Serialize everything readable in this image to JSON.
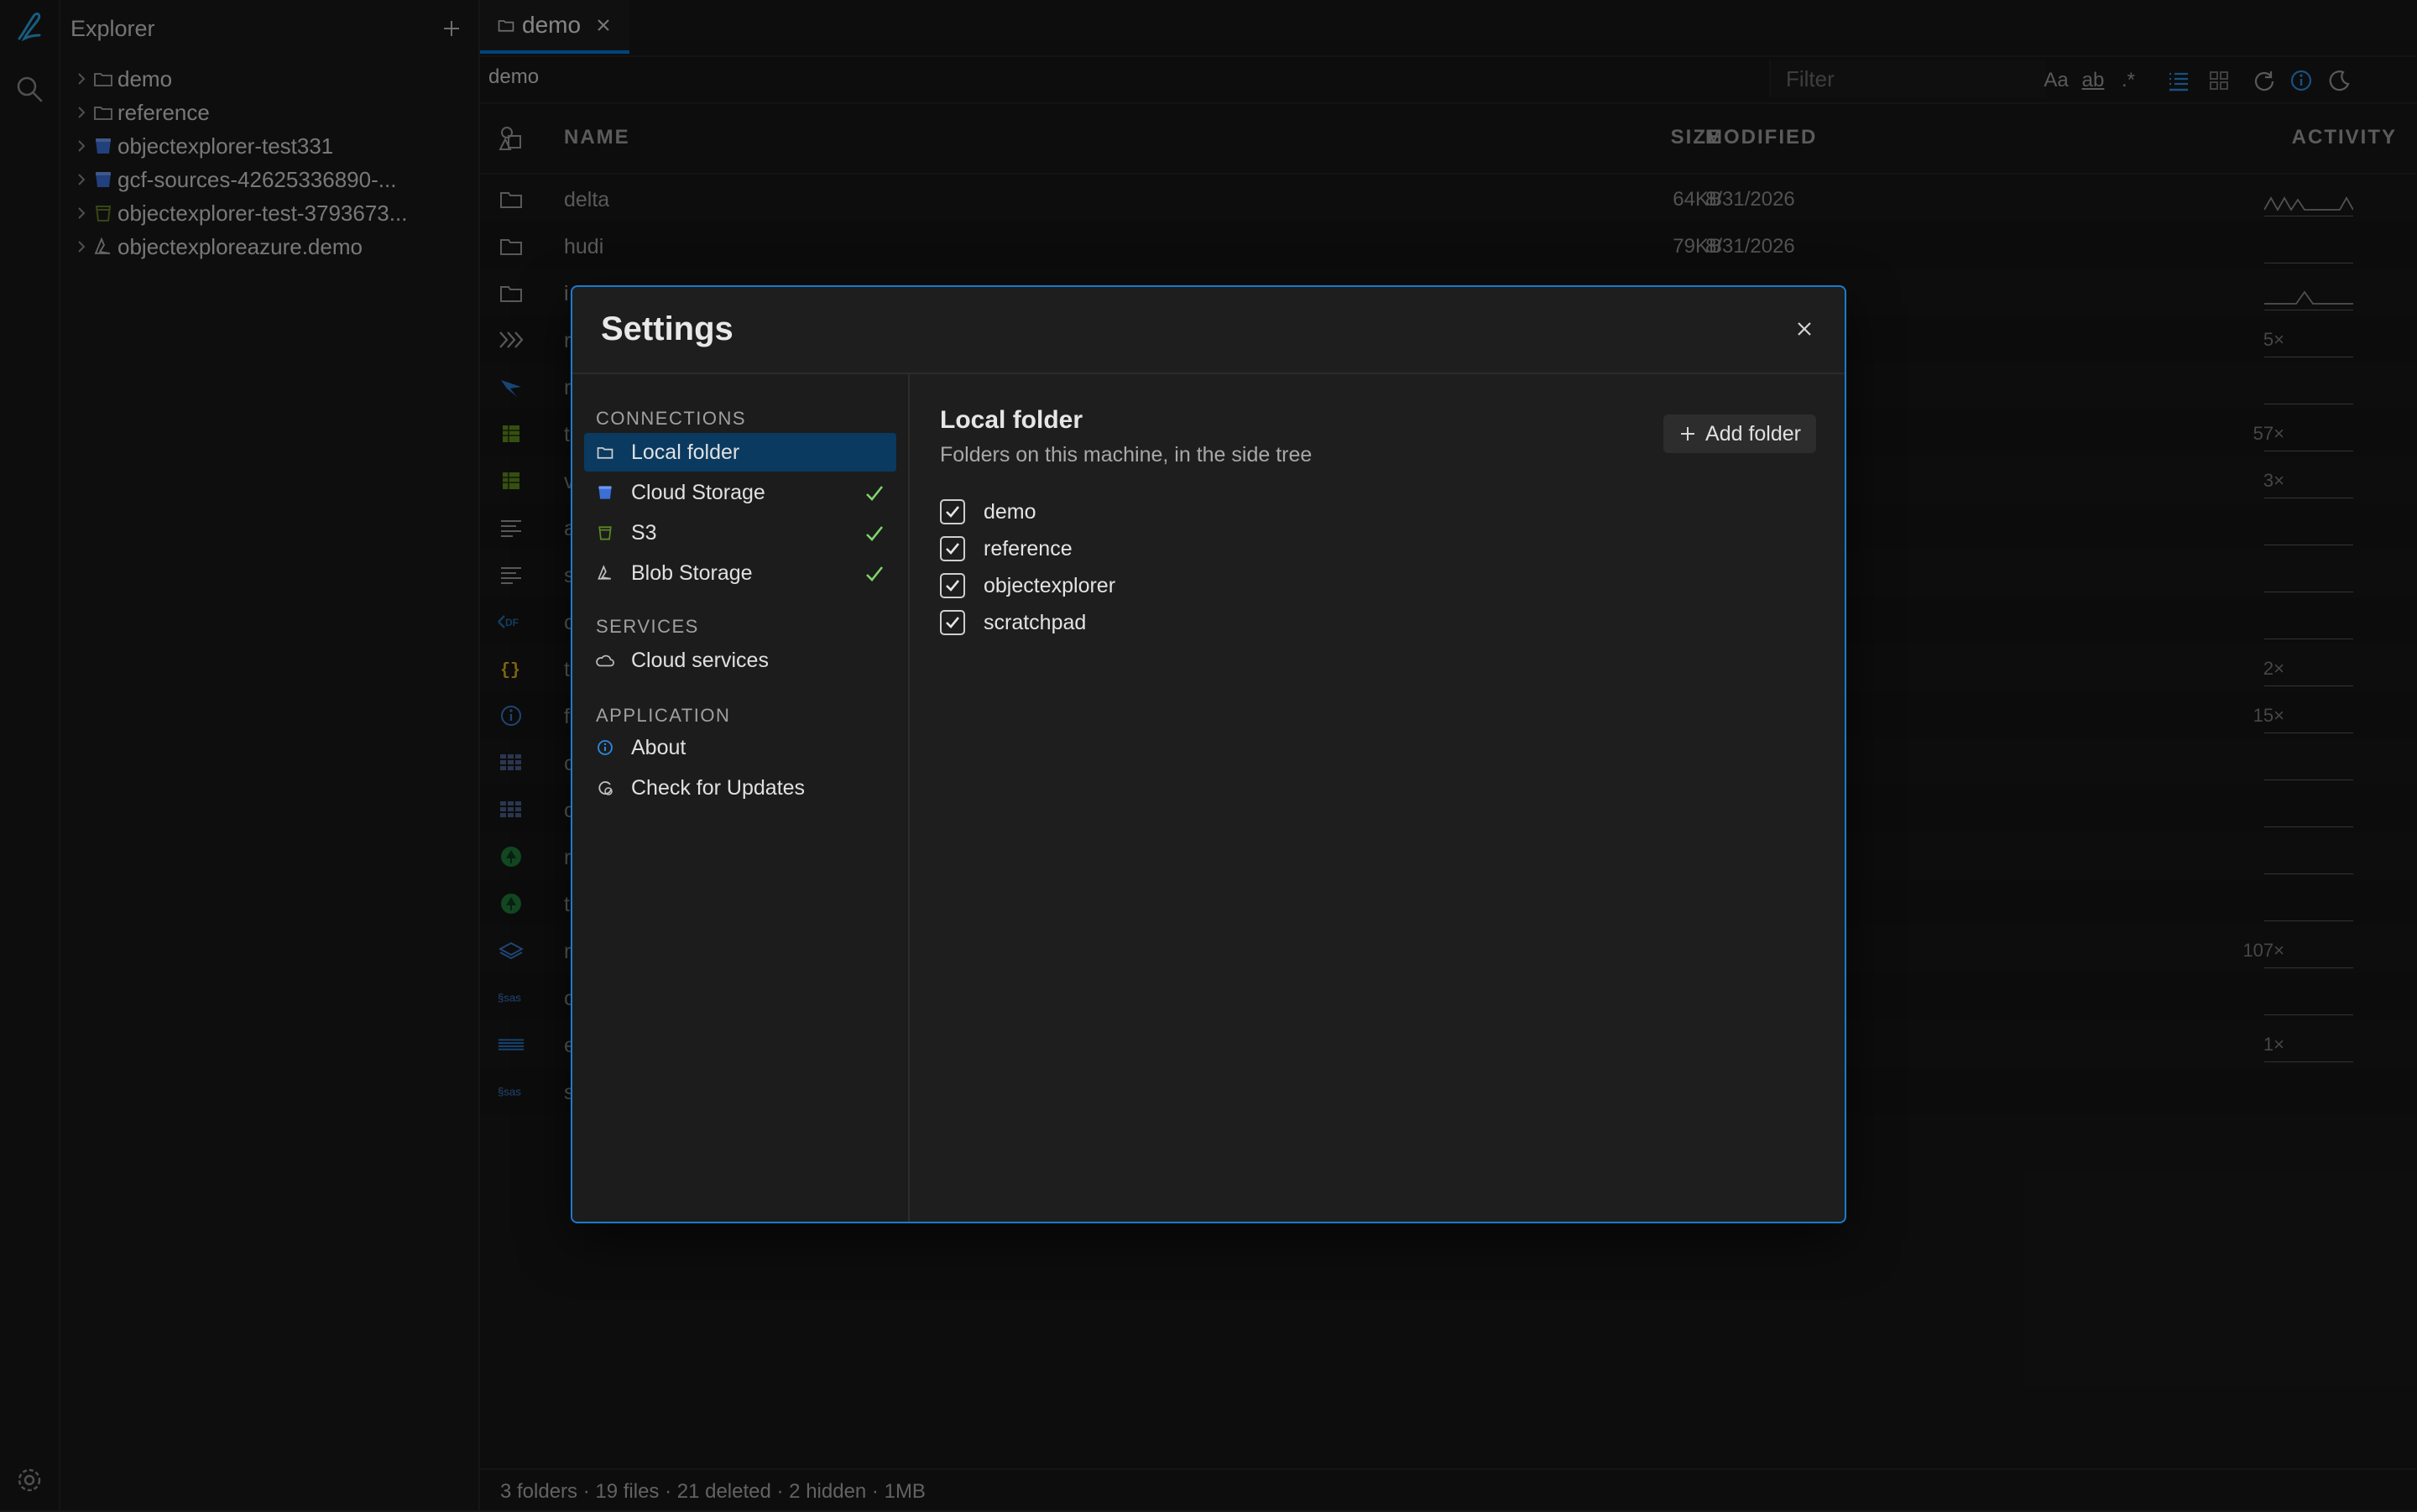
{
  "explorer": {
    "title": "Explorer",
    "items": [
      {
        "label": "demo",
        "icon": "folder-icon"
      },
      {
        "label": "reference",
        "icon": "folder-icon"
      },
      {
        "label": "objectexplorer-test331",
        "icon": "bucket-icon"
      },
      {
        "label": "gcf-sources-42625336890-...",
        "icon": "bucket-icon"
      },
      {
        "label": "objectexplorer-test-3793673...",
        "icon": "s3-icon"
      },
      {
        "label": "objectexploreazure.demo",
        "icon": "azure-icon"
      }
    ]
  },
  "tab": {
    "label": "demo"
  },
  "toolbar": {
    "breadcrumb": "demo",
    "filter_placeholder": "Filter",
    "case_label": "Aa",
    "word_label": "ab",
    "regex_label": ".*"
  },
  "table": {
    "headers": {
      "name": "NAME",
      "size": "SIZE",
      "modified": "MODIFIED",
      "activity": "ACTIVITY"
    },
    "rows": [
      {
        "name": "delta",
        "size": "64KB",
        "modified": "8/31/2026",
        "count": "",
        "icon": "folder-icon",
        "spark": "wave"
      },
      {
        "name": "hudi",
        "size": "79KB",
        "modified": "8/31/2026",
        "count": "",
        "icon": "folder-icon",
        "spark": "flat"
      },
      {
        "name": "i",
        "size": "",
        "modified": "",
        "count": "",
        "icon": "folder-icon",
        "spark": "peak"
      },
      {
        "name": "r",
        "size": "",
        "modified": "",
        "count": "5×",
        "icon": "chevrons-icon",
        "spark": "flat"
      },
      {
        "name": "r",
        "size": "",
        "modified": "",
        "count": "",
        "icon": "bird-icon",
        "spark": "flat"
      },
      {
        "name": "t",
        "size": "",
        "modified": "",
        "count": "57×",
        "icon": "sheet-icon",
        "spark": "flat"
      },
      {
        "name": "v",
        "size": "",
        "modified": "",
        "count": "3×",
        "icon": "sheet-icon",
        "spark": "flat"
      },
      {
        "name": "a",
        "size": "",
        "modified": "",
        "count": "",
        "icon": "text-icon",
        "spark": "flat"
      },
      {
        "name": "s",
        "size": "",
        "modified": "",
        "count": "",
        "icon": "text-icon",
        "spark": "flat"
      },
      {
        "name": "c",
        "size": "",
        "modified": "",
        "count": "",
        "icon": "hdf-icon",
        "spark": "flat"
      },
      {
        "name": "t",
        "size": "",
        "modified": "",
        "count": "2×",
        "icon": "json-icon",
        "spark": "flat"
      },
      {
        "name": "f",
        "size": "",
        "modified": "",
        "count": "15×",
        "icon": "info-icon",
        "spark": "flat"
      },
      {
        "name": "c",
        "size": "",
        "modified": "",
        "count": "",
        "icon": "grid-icon",
        "spark": "flat"
      },
      {
        "name": "c",
        "size": "",
        "modified": "",
        "count": "",
        "icon": "grid-icon",
        "spark": "flat"
      },
      {
        "name": "r",
        "size": "",
        "modified": "",
        "count": "",
        "icon": "tree-icon",
        "spark": "flat"
      },
      {
        "name": "t",
        "size": "",
        "modified": "",
        "count": "",
        "icon": "tree-icon",
        "spark": "flat"
      },
      {
        "name": "r",
        "size": "",
        "modified": "",
        "count": "107×",
        "icon": "layers-icon",
        "spark": "flat"
      },
      {
        "name": "c",
        "size": "",
        "modified": "",
        "count": "",
        "icon": "sas-icon",
        "spark": "flat"
      },
      {
        "name": "e",
        "size": "",
        "modified": "",
        "count": "1×",
        "icon": "ibm-icon",
        "spark": "flat"
      },
      {
        "name": "s",
        "size": "",
        "modified": "",
        "count": "",
        "icon": "sas-icon",
        "spark": ""
      }
    ]
  },
  "status": {
    "text": "3 folders · 19 files · 21 deleted · 2 hidden · 1MB"
  },
  "settings": {
    "title": "Settings",
    "nav": {
      "section_connections": "CONNECTIONS",
      "section_services": "SERVICES",
      "section_application": "APPLICATION",
      "local_folder": "Local folder",
      "cloud_storage": "Cloud Storage",
      "s3": "S3",
      "blob_storage": "Blob Storage",
      "cloud_services": "Cloud services",
      "about": "About",
      "check_updates": "Check for Updates"
    },
    "content": {
      "title": "Local folder",
      "subtitle": "Folders on this machine, in the side tree",
      "add_button": "Add folder",
      "folders": [
        {
          "label": "demo",
          "checked": true
        },
        {
          "label": "reference",
          "checked": true
        },
        {
          "label": "objectexplorer",
          "checked": true
        },
        {
          "label": "scratchpad",
          "checked": true
        }
      ]
    }
  },
  "colors": {
    "accent": "#0078d4",
    "check_green": "#7fd36a",
    "selected_nav": "#0a3a60",
    "modal_border": "#1a7bd0"
  }
}
